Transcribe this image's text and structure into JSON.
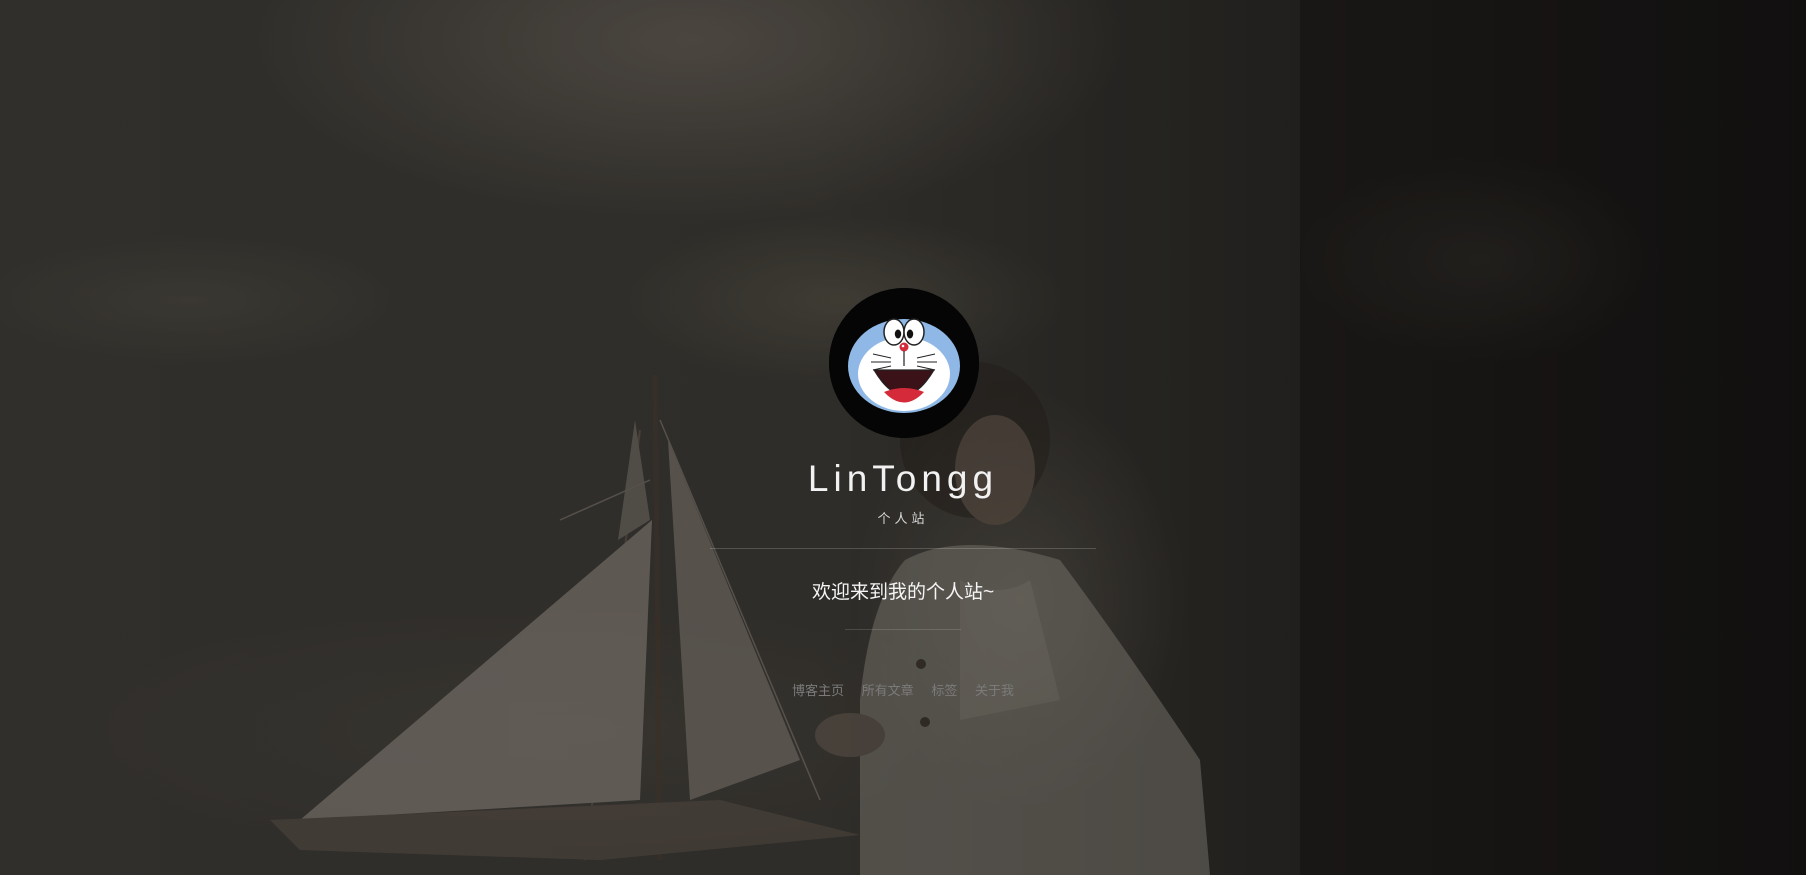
{
  "site": {
    "title": "LinTongg",
    "subtitle": "个人站",
    "welcome": "欢迎来到我的个人站~"
  },
  "nav": {
    "items": [
      {
        "label": "博客主页"
      },
      {
        "label": "所有文章"
      },
      {
        "label": "标签"
      },
      {
        "label": "关于我"
      }
    ]
  },
  "avatar": {
    "icon": "doraemon-face-icon"
  },
  "colors": {
    "title_text": "#f2f2f2",
    "nav_text": "#7b7b7b",
    "avatar_bg": "#050505",
    "doraemon_blue": "#8fb8e6",
    "mouth_red": "#d42a3a"
  }
}
